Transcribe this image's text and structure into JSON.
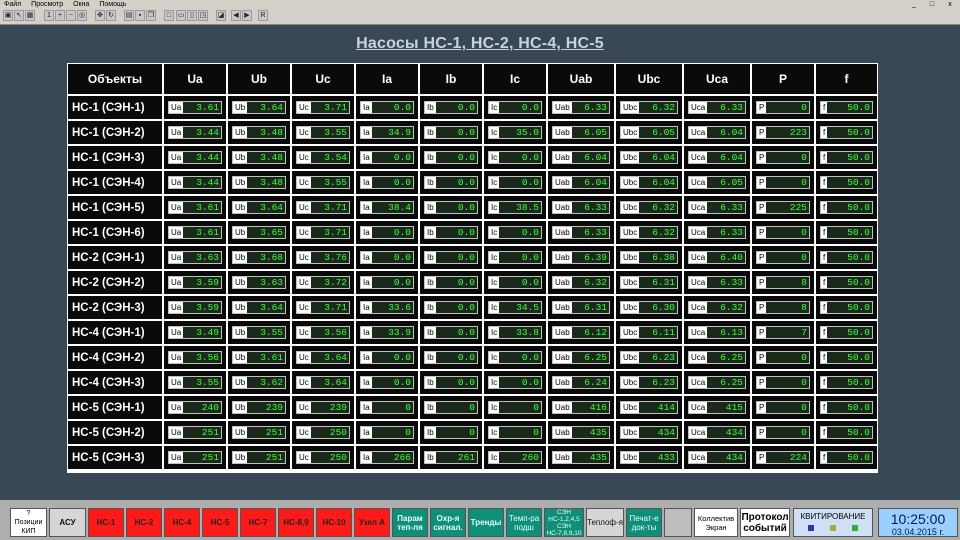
{
  "menu": [
    "Файл",
    "Просмотр",
    "Окна",
    "Помощь"
  ],
  "window_controls": [
    "_",
    "□",
    "x"
  ],
  "toolbar": {
    "last_label": "R"
  },
  "title": "Насосы НС-1, НС-2, НС-4, НС-5",
  "table": {
    "columns": [
      "Объекты",
      "Ua",
      "Ub",
      "Uc",
      "Ia",
      "Ib",
      "Ic",
      "Uab",
      "Ubc",
      "Uca",
      "P",
      "f"
    ],
    "rows": [
      {
        "name": "НС-1 (СЭН-1)",
        "values": [
          "3.61",
          "3.64",
          "3.71",
          "0.0",
          "0.0",
          "0.0",
          "6.33",
          "6.32",
          "6.33",
          "0",
          "50.0"
        ]
      },
      {
        "name": "НС-1 (СЭН-2)",
        "values": [
          "3.44",
          "3.48",
          "3.55",
          "34.9",
          "0.0",
          "35.0",
          "6.05",
          "6.05",
          "6.04",
          "223",
          "50.0"
        ]
      },
      {
        "name": "НС-1 (СЭН-3)",
        "values": [
          "3.44",
          "3.48",
          "3.54",
          "0.0",
          "0.0",
          "0.0",
          "6.04",
          "6.04",
          "6.04",
          "0",
          "50.0"
        ]
      },
      {
        "name": "НС-1 (СЭН-4)",
        "values": [
          "3.44",
          "3.48",
          "3.55",
          "0.0",
          "0.0",
          "0.0",
          "6.04",
          "6.04",
          "6.05",
          "0",
          "50.0"
        ]
      },
      {
        "name": "НС-1 (СЭН-5)",
        "values": [
          "3.61",
          "3.64",
          "3.71",
          "38.4",
          "0.0",
          "38.5",
          "6.33",
          "6.32",
          "6.33",
          "225",
          "50.0"
        ]
      },
      {
        "name": "НС-1 (СЭН-6)",
        "values": [
          "3.61",
          "3.65",
          "3.71",
          "0.0",
          "0.0",
          "0.0",
          "6.33",
          "6.32",
          "6.33",
          "0",
          "50.0"
        ]
      },
      {
        "name": "НС-2 (СЭН-1)",
        "values": [
          "3.63",
          "3.68",
          "3.76",
          "0.0",
          "0.0",
          "0.0",
          "6.39",
          "6.38",
          "6.40",
          "0",
          "50.0"
        ]
      },
      {
        "name": "НС-2 (СЭН-2)",
        "values": [
          "3.59",
          "3.63",
          "3.72",
          "0.0",
          "0.0",
          "0.0",
          "6.32",
          "6.31",
          "6.33",
          "8",
          "50.0"
        ]
      },
      {
        "name": "НС-2 (СЭН-3)",
        "values": [
          "3.59",
          "3.64",
          "3.71",
          "33.6",
          "0.0",
          "34.5",
          "6.31",
          "6.30",
          "6.32",
          "8",
          "50.0"
        ]
      },
      {
        "name": "НС-4 (СЭН-1)",
        "values": [
          "3.49",
          "3.55",
          "3.56",
          "33.9",
          "0.0",
          "33.8",
          "6.12",
          "6.11",
          "6.13",
          "7",
          "50.0"
        ]
      },
      {
        "name": "НС-4 (СЭН-2)",
        "values": [
          "3.56",
          "3.61",
          "3.64",
          "0.0",
          "0.0",
          "0.0",
          "6.25",
          "6.23",
          "6.25",
          "0",
          "50.0"
        ]
      },
      {
        "name": "НС-4 (СЭН-3)",
        "values": [
          "3.55",
          "3.62",
          "3.64",
          "0.0",
          "0.0",
          "0.0",
          "6.24",
          "6.23",
          "6.25",
          "0",
          "50.0"
        ]
      },
      {
        "name": "НС-5 (СЭН-1)",
        "values": [
          "240",
          "239",
          "239",
          "0",
          "0",
          "0",
          "416",
          "414",
          "415",
          "0",
          "50.0"
        ]
      },
      {
        "name": "НС-5 (СЭН-2)",
        "values": [
          "251",
          "251",
          "250",
          "0",
          "0",
          "0",
          "435",
          "434",
          "434",
          "0",
          "50.0"
        ]
      },
      {
        "name": "НС-5 (СЭН-3)",
        "values": [
          "251",
          "251",
          "250",
          "266",
          "261",
          "260",
          "435",
          "433",
          "434",
          "224",
          "50.0"
        ]
      }
    ]
  },
  "bottom": {
    "kip": {
      "line1": "?",
      "line2": "Позиции",
      "line3": "КИП"
    },
    "asu": "АСУ",
    "pumps": [
      "НС-1",
      "НС-2",
      "НС-4",
      "НС-5",
      "НС-7",
      "НС-8,9",
      "НС-10",
      "Узел А"
    ],
    "teal": [
      {
        "l1": "Парам",
        "l2": "теп-ля"
      },
      {
        "l1": "Охр-я",
        "l2": "сигнал."
      },
      {
        "l1": "Тренды",
        "l2": ""
      },
      {
        "l1": "Темп-ра",
        "l2": "подш"
      }
    ],
    "sen": {
      "l1": "СЭН",
      "l2": "НС-1,2,4,5",
      "l3": "СЭН",
      "l4": "НС-7,8,9,10"
    },
    "teplof": "Теплоф-я",
    "print": {
      "l1": "Печат-е",
      "l2": "док-ты"
    },
    "collect": {
      "l1": "Коллектив",
      "l2": "Экран"
    },
    "protocol": {
      "l1": "Протокол",
      "l2": "событий"
    },
    "kvit": "КВИТИРОВАНИЕ",
    "time": "10:25:00",
    "date": "03.04.2015 г."
  },
  "colors": {
    "background": "#3a4755",
    "cell": "#0a0a0a",
    "value": "#3cff3c",
    "pump_button": "#ff1a1a",
    "teal_button": "#0f8f7a"
  }
}
